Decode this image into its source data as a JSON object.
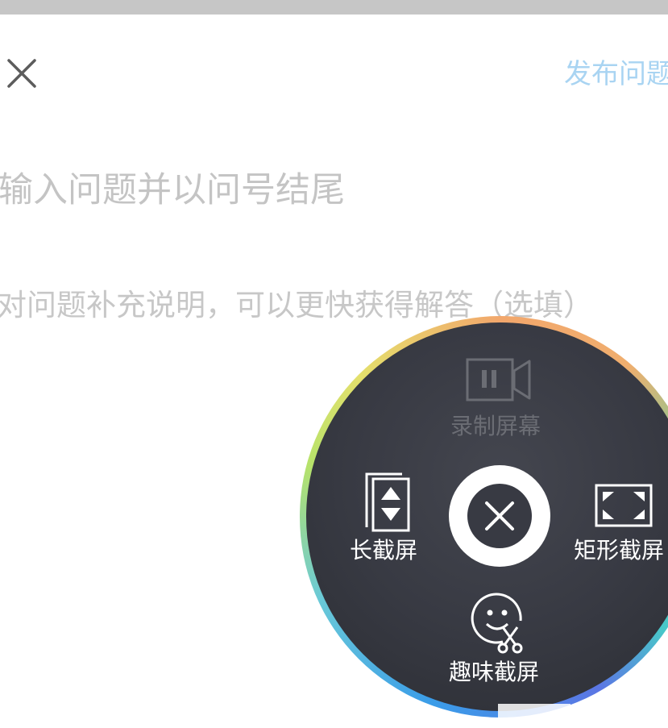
{
  "header": {
    "close_icon": "close-icon",
    "publish_label": "发布问题"
  },
  "question": {
    "placeholder": "输入问题并以问号结尾"
  },
  "detail": {
    "placeholder": "对问题补充说明，可以更快获得解答（选填）"
  },
  "screenshot_menu": {
    "record": {
      "label": "录制屏幕",
      "icon": "video-camera-pause-icon",
      "enabled": false
    },
    "long": {
      "label": "长截屏",
      "icon": "long-screenshot-icon"
    },
    "rect": {
      "label": "矩形截屏",
      "icon": "rect-screenshot-icon"
    },
    "fun": {
      "label": "趣味截屏",
      "icon": "smiley-scissors-icon"
    },
    "close_icon": "close-icon"
  },
  "colors": {
    "publish": "#a9d4f2",
    "placeholder": "#c4c4c4",
    "menu_bg": "#383a43"
  }
}
